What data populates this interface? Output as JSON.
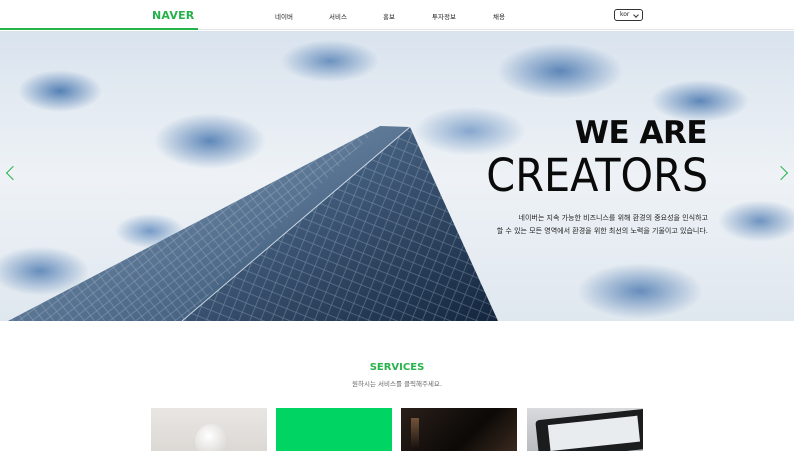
{
  "header": {
    "logo": "NAVER",
    "nav": [
      "네이버",
      "서비스",
      "홍보",
      "투자정보",
      "채용"
    ],
    "language": "kor"
  },
  "hero": {
    "title_line1": "WE ARE",
    "title_line2": "CREATORS",
    "description_line1": "네이버는 지속 가능한 비즈니스를 위해 환경의 중요성을 인식하고",
    "description_line2": "할 수 있는 모든 영역에서 환경을 위한 최선의 노력을 기울이고 있습니다."
  },
  "services": {
    "title": "SERVICES",
    "subtitle": "원하시는 서비스를 클릭해주세요."
  },
  "colors": {
    "brand_green": "#27b24b",
    "service_card_green": "#00d564"
  },
  "icons": [
    "chevron-left-icon",
    "chevron-right-icon",
    "chevron-down-icon"
  ]
}
